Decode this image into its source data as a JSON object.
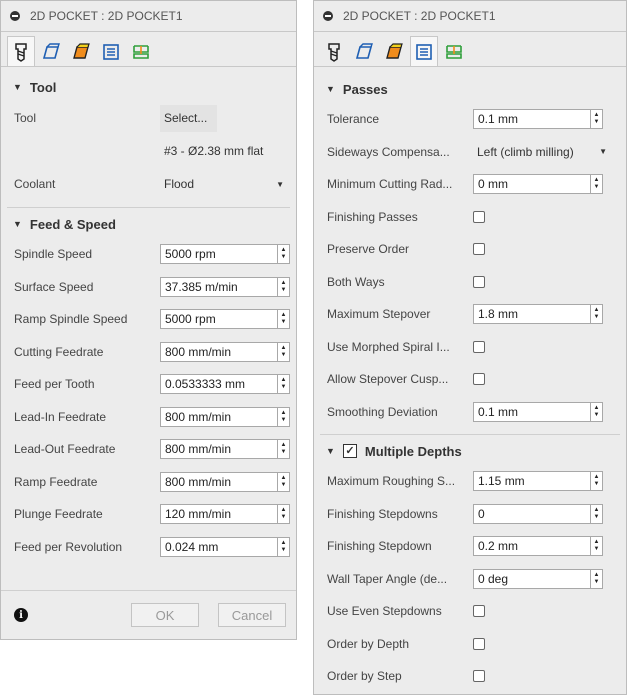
{
  "left": {
    "title": "2D POCKET : 2D POCKET1",
    "tool_section": {
      "header": "Tool",
      "tool_label": "Tool",
      "select_button": "Select...",
      "tool_desc": "#3 - Ø2.38 mm flat",
      "coolant_label": "Coolant",
      "coolant_value": "Flood"
    },
    "feed_section": {
      "header": "Feed & Speed",
      "rows": [
        {
          "label": "Spindle Speed",
          "value": "5000 rpm"
        },
        {
          "label": "Surface Speed",
          "value": "37.385 m/min"
        },
        {
          "label": "Ramp Spindle Speed",
          "value": "5000 rpm"
        },
        {
          "label": "Cutting Feedrate",
          "value": "800 mm/min"
        },
        {
          "label": "Feed per Tooth",
          "value": "0.0533333 mm"
        },
        {
          "label": "Lead-In Feedrate",
          "value": "800 mm/min"
        },
        {
          "label": "Lead-Out Feedrate",
          "value": "800 mm/min"
        },
        {
          "label": "Ramp Feedrate",
          "value": "800 mm/min"
        },
        {
          "label": "Plunge Feedrate",
          "value": "120 mm/min"
        },
        {
          "label": "Feed per Revolution",
          "value": "0.024 mm"
        }
      ]
    },
    "footer": {
      "info": "i",
      "ok": "OK",
      "cancel": "Cancel"
    }
  },
  "right": {
    "title": "2D POCKET : 2D POCKET1",
    "passes_section": {
      "header": "Passes",
      "tolerance_label": "Tolerance",
      "tolerance_value": "0.1 mm",
      "sideways_label": "Sideways Compensa...",
      "sideways_value": "Left (climb milling)",
      "min_radius_label": "Minimum Cutting Rad...",
      "min_radius_value": "0 mm",
      "finishing_passes_label": "Finishing Passes",
      "preserve_order_label": "Preserve Order",
      "both_ways_label": "Both Ways",
      "max_stepover_label": "Maximum Stepover",
      "max_stepover_value": "1.8 mm",
      "morphed_spiral_label": "Use Morphed Spiral I...",
      "allow_cusp_label": "Allow Stepover Cusp...",
      "smoothing_label": "Smoothing Deviation",
      "smoothing_value": "0.1 mm"
    },
    "depths_section": {
      "header": "Multiple Depths",
      "max_roughing_label": "Maximum Roughing S...",
      "max_roughing_value": "1.15 mm",
      "finishing_stepdowns_label": "Finishing Stepdowns",
      "finishing_stepdowns_value": "0",
      "finishing_stepdown_label": "Finishing Stepdown",
      "finishing_stepdown_value": "0.2 mm",
      "wall_taper_label": "Wall Taper Angle (de...",
      "wall_taper_value": "0 deg",
      "even_stepdowns_label": "Use Even Stepdowns",
      "order_depth_label": "Order by Depth",
      "order_step_label": "Order by Step"
    }
  },
  "colors": {
    "panel_bg": "#ececec",
    "tab_green": "#2e9e3a",
    "tab_orange": "#f08c1c",
    "tab_blue": "#1f5fb3",
    "tab_yellow": "#f2d21b"
  }
}
